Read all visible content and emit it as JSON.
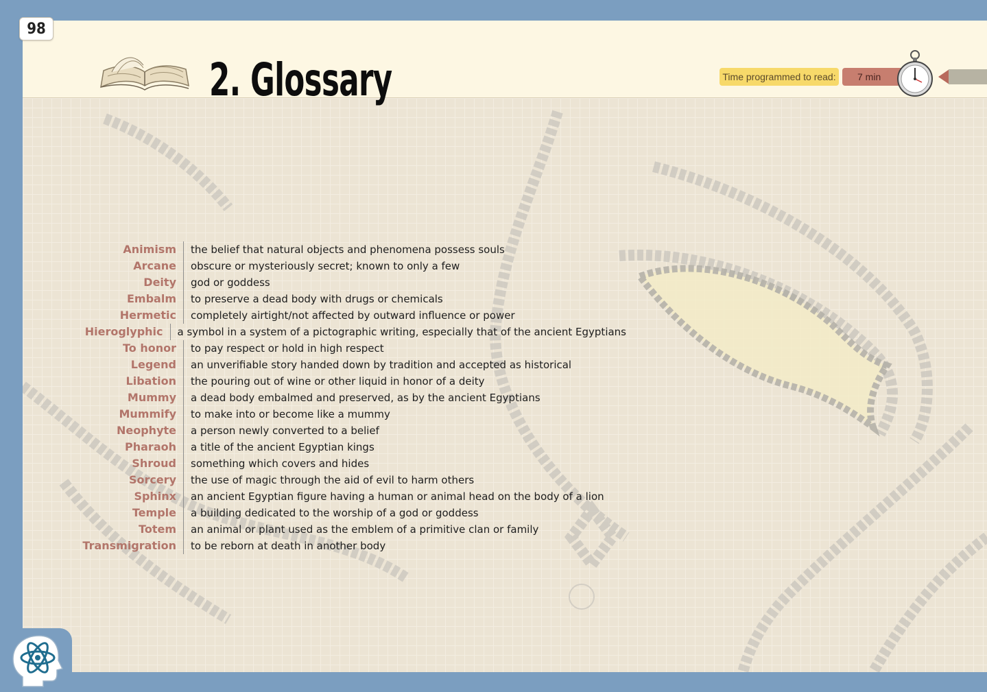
{
  "page_number": "98",
  "header": {
    "title": "2. Glossary",
    "time_label": "Time programmed to read:",
    "time_value": "7 min",
    "icons": [
      "book-icon",
      "stopwatch-icon",
      "arrow-left-icon",
      "brain-atom-logo"
    ]
  },
  "glossary": [
    {
      "term": "Animism",
      "definition": "the belief that natural objects and phenomena possess souls"
    },
    {
      "term": "Arcane",
      "definition": "obscure or mysteriously secret; known to only a few"
    },
    {
      "term": "Deity",
      "definition": "god or goddess"
    },
    {
      "term": "Embalm",
      "definition": "to preserve a dead body with drugs or chemicals"
    },
    {
      "term": "Hermetic",
      "definition": "completely airtight/not affected by outward influence or power"
    },
    {
      "term": "Hieroglyphic",
      "definition": "a symbol in a system of a pictographic writing, especially that of the ancient Egyptians"
    },
    {
      "term": "To honor",
      "definition": "to pay respect or hold in high respect"
    },
    {
      "term": "Legend",
      "definition": "an unverifiable story handed down by tradition and accepted as historical"
    },
    {
      "term": "Libation",
      "definition": "the pouring out of wine or other liquid in honor of a deity"
    },
    {
      "term": "Mummy",
      "definition": "a dead body embalmed and preserved, as by the ancient Egyptians"
    },
    {
      "term": "Mummify",
      "definition": "to make into or become like a mummy"
    },
    {
      "term": "Neophyte",
      "definition": "a person newly converted to a belief"
    },
    {
      "term": "Pharaoh",
      "definition": "a title of the ancient Egyptian kings"
    },
    {
      "term": "Shroud",
      "definition": "something which covers and hides"
    },
    {
      "term": "Sorcery",
      "definition": "the use of magic through the aid of evil to harm others"
    },
    {
      "term": "Sphinx",
      "definition": "an ancient Egyptian figure having a human or animal head on the body of a lion"
    },
    {
      "term": "Temple",
      "definition": "a building dedicated to the worship of a god or goddess"
    },
    {
      "term": "Totem",
      "definition": "an animal or plant used as the emblem of a primitive clan or family"
    },
    {
      "term": "Transmigration",
      "definition": "to be reborn at death in another body"
    }
  ],
  "colors": {
    "frame": "#7b9ec0",
    "header_bg": "#fdf7e3",
    "term": "#b2756a",
    "time_label_bg": "#f7d96a",
    "time_value_bg": "#c77e6f"
  }
}
